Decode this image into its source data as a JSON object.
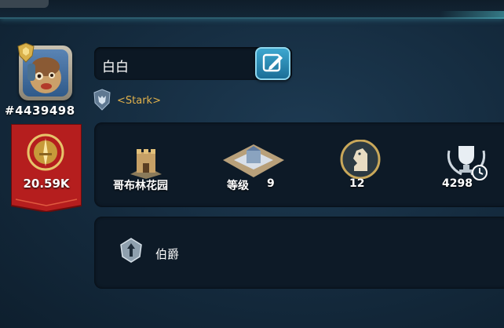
{
  "player": {
    "id": "#4439498",
    "name": "白白",
    "alliance_tag": "<Stark>",
    "power": "20.59K"
  },
  "stats": {
    "city": {
      "label": "哥布林花园",
      "icon": "castle-icon"
    },
    "level": {
      "prefix": "等级",
      "value": "9",
      "icon": "fortress-icon"
    },
    "knight": {
      "value": "12",
      "icon": "knight-chess-icon"
    },
    "trophy": {
      "value": "4298",
      "icon": "trophy-icon"
    }
  },
  "title": {
    "label": "伯爵",
    "icon": "rank-emblem-icon"
  },
  "colors": {
    "accent_cyan": "#3da7cf",
    "banner_red": "#b51e1e",
    "alliance_gold": "#e2b24c"
  }
}
